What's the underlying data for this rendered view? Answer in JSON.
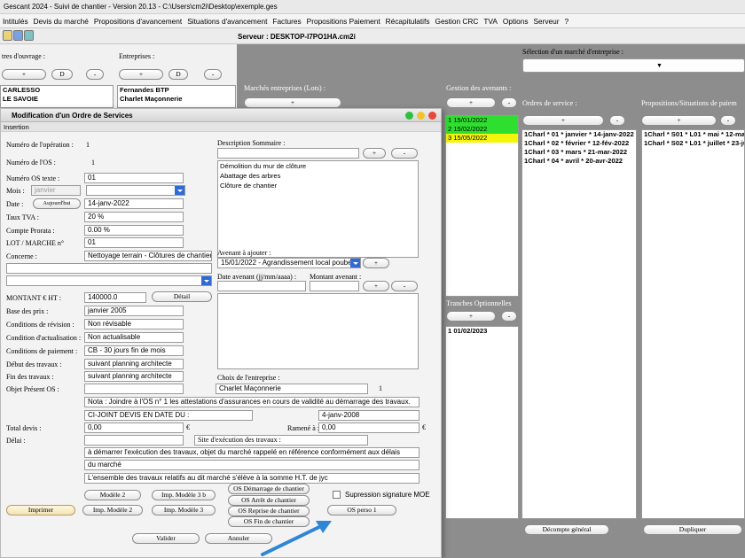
{
  "window": {
    "title": "Gescant 2024 - Suivi de chantier - Version 20.13 - C:\\Users\\cm2i\\Desktop\\exemple.ges"
  },
  "menu": [
    "Intitulés",
    "Devis du marché",
    "Propositions d'avancement",
    "Situations d'avancement",
    "Factures",
    "Propositions Paiement",
    "Récapitulatifs",
    "Gestion CRC",
    "TVA",
    "Options",
    "Serveur",
    "?"
  ],
  "server": "Serveur : DESKTOP-I7PO1HA.cm2i",
  "left": {
    "maitres_label": "tres d'ouvrage :",
    "entreprises_label": "Entreprises :",
    "btn_plus": "+",
    "btn_d": "D",
    "btn_minus": "-",
    "maitres": [
      "CARLESSO",
      "LE SAVOIE"
    ],
    "entreprises": [
      "Fernandes BTP",
      "Charlet Maçonnerie"
    ]
  },
  "right": {
    "selection_label": "Sélection d'un marché d'entreprise :",
    "marches_label": "Marchés entreprises (Lots) :",
    "avenants_label": "Gestion des avenants :",
    "avenants": [
      "1 15/01/2022",
      "2 15/02/2022",
      "3 15/05/2022"
    ],
    "ordres_label": "Ordres de service :",
    "ordres": [
      "1Charl * 01 * janvier * 14-janv-2022",
      "1Charl * 02 * février * 12-fév-2022",
      "1Charl * 03 * mars * 21-mar-2022",
      "1Charl * 04 * avril * 20-avr-2022"
    ],
    "propositions_label": "Propositions/Situations de paiem",
    "propositions": [
      "1Charl * S01 * L01 * mai * 12-ma",
      "1Charl * S02 * L01 * juillet * 23-ju"
    ],
    "tranches_label": "Tranches Optionnelles",
    "tranches": [
      "1 01/02/2023"
    ],
    "decompte": "Décompte général",
    "dupliquer": "Dupliquer"
  },
  "dialog": {
    "title": "Modification d'un Ordre de Services",
    "tab": "Insertion",
    "num_operation_label": "Numéro de l'opération :",
    "num_operation": "1",
    "num_os_label": "Numéro de l'OS :",
    "num_os": "1",
    "num_os_texte_label": "Numéro OS texte :",
    "num_os_texte": "01",
    "mois_label": "Mois :",
    "mois": "janvier",
    "date_label": "Date :",
    "aujourdhui": "Aujourd'hui",
    "date": "14-janv-2022",
    "tva_label": "Taux TVA :",
    "tva": "20 %",
    "prorata_label": "Compte Prorata :",
    "prorata": "0.00 %",
    "lot_label": "LOT / MARCHE n°",
    "lot": "01",
    "concerne_label": "Concerne :",
    "concerne": "Nettoyage terrain - Clôtures de chantier",
    "montant_label": "MONTANT € HT :",
    "montant": "140000.0",
    "detail": "Détail",
    "base_prix_label": "Base des prix :",
    "base_prix": "janvier 2005",
    "revision_label": "Conditions de révision :",
    "revision": "Non révisable",
    "actualisation_label": "Condition d'actualisation :",
    "actualisation": "Non actualisable",
    "paiement_label": "Conditions de paiement :",
    "paiement": "CB - 30 jours fin de mois",
    "debut_label": "Début des travaux :",
    "debut": "suivant planning architecte",
    "fin_label": "Fin des travaux :",
    "fin": "suivant planning architecte",
    "objet_label": "Objet Présent OS :",
    "description_label": "Description Sommaire :",
    "description": [
      "Démolition du mur de clôture",
      "Abattage des arbres",
      "Clôture de chantier"
    ],
    "avenant_label": "Avenant à ajouter :",
    "avenant_select": "15/01/2022 - Agrandissement local poubell.",
    "date_avenant_label": "Date avenant (jj/mm/aaaa) :",
    "montant_avenant_label": "Montant avenant :",
    "choix_label": "Choix de l'entreprise :",
    "choix": "Charlet Maçonnerie",
    "choix_num": "1",
    "nota": "Nota : Joindre à l'OS n° 1 les attestations d'assurances en cours de validité au démarrage des travaux.",
    "joint": "CI-JOINT DEVIS EN DATE DU :",
    "joint_date": "4-janv-2008",
    "total_label": "Total devis :",
    "total": "0,00",
    "euro": "€",
    "ramene_label": "Ramené à :",
    "ramene": "0,00",
    "delai_label": "Délai :",
    "site_label": "Site d'exécution des travaux :",
    "text1": "à démarrer l'exécution des travaux, objet du marché rappelé en référence conformément aux délais",
    "text2": "du marché",
    "text3": "L'ensemble des travaux relatifs au dit marché s'élève à la somme H.T. de jyc",
    "modele2": "Modèle 2",
    "imp_modele3b": "Imp. Modèle 3 b",
    "os_demarrage": "OS Démarrage de chantier",
    "os_arret": "OS Arrêt de chantier",
    "os_reprise": "OS Reprise de chantier",
    "os_fin": "OS Fin de chantier",
    "supression": "Supression signature MOE",
    "imprimer": "Imprimer",
    "imp_modele2": "Imp. Modèle 2",
    "imp_modele3": "Imp. Modèle 3",
    "os_perso": "OS perso 1",
    "valider": "Valider",
    "annuler": "Annuler"
  }
}
